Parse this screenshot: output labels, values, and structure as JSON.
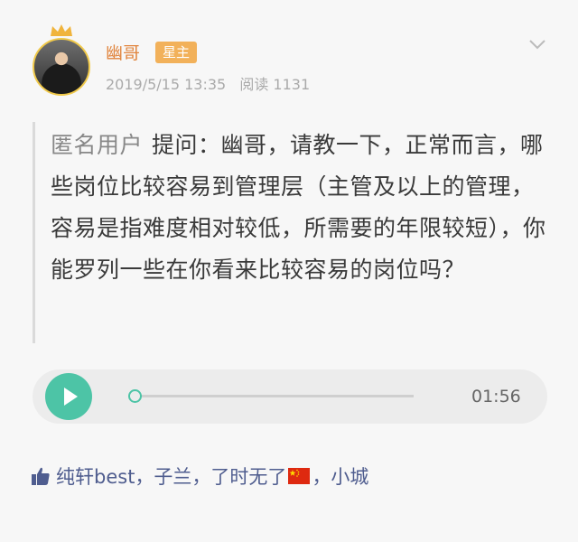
{
  "post": {
    "author": "幽哥",
    "badge": "星主",
    "date": "2019/5/15 13:35",
    "reads": "阅读 1131"
  },
  "question": {
    "asker": "匿名用户",
    "text": "提问：幽哥，请教一下，正常而言，哪些岗位比较容易到管理层（主管及以上的管理，容易是指难度相对较低，所需要的年限较短），你能罗列一些在你看来比较容易的岗位吗？"
  },
  "audio": {
    "duration": "01:56",
    "progress": 0
  },
  "likes": {
    "text_before_flag": "纯轩best，子兰，了时无了",
    "flag_icon": "china-flag-icon",
    "text_after_flag": "，小城"
  },
  "colors": {
    "author": "#e1843d",
    "badge": "#f2b15a",
    "accent": "#4dc4a6",
    "likes": "#4f5d8f"
  }
}
